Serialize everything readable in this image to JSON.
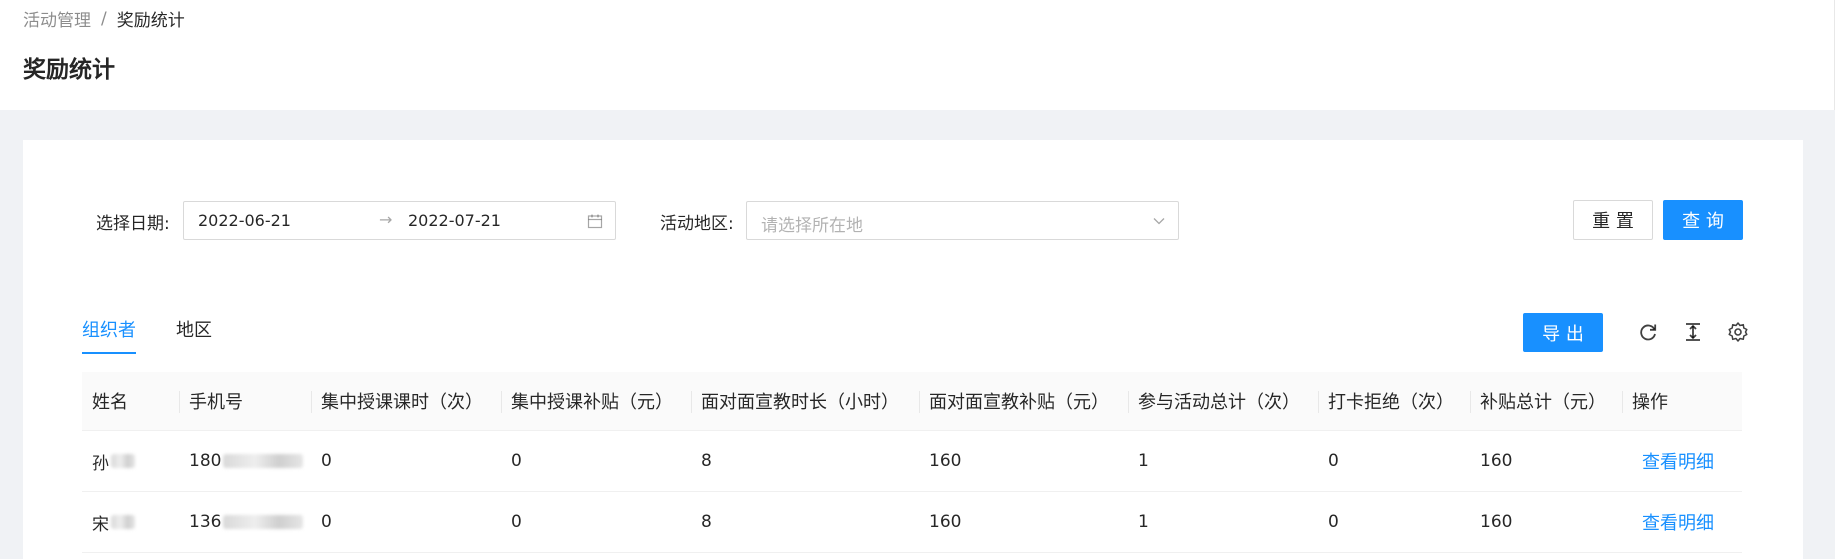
{
  "breadcrumb": {
    "parent": "活动管理",
    "separator": "/",
    "current": "奖励统计"
  },
  "page_title": "奖励统计",
  "filters": {
    "date_label": "选择日期:",
    "start_date": "2022-06-21",
    "range_arrow": "→",
    "end_date": "2022-07-21",
    "region_label": "活动地区:",
    "region_placeholder": "请选择所在地",
    "reset_label": "重 置",
    "query_label": "查 询"
  },
  "tabs": [
    {
      "label": "组织者",
      "active": true
    },
    {
      "label": "地区",
      "active": false
    }
  ],
  "toolbar": {
    "export_label": "导 出"
  },
  "table": {
    "columns": [
      "姓名",
      "手机号",
      "集中授课课时（次）",
      "集中授课补贴（元）",
      "面对面宣教时长（小时）",
      "面对面宣教补贴（元）",
      "参与活动总计（次）",
      "打卡拒绝（次）",
      "补贴总计（元）",
      "操作"
    ],
    "rows": [
      {
        "name": "孙",
        "phone": "180",
        "lesson_count": "0",
        "lesson_subsidy": "0",
        "f2f_hours": "8",
        "f2f_subsidy": "160",
        "activity_total": "1",
        "checkin_reject": "0",
        "subsidy_total": "160",
        "action": "查看明细"
      },
      {
        "name": "宋",
        "phone": "136",
        "lesson_count": "0",
        "lesson_subsidy": "0",
        "f2f_hours": "8",
        "f2f_subsidy": "160",
        "activity_total": "1",
        "checkin_reject": "0",
        "subsidy_total": "160",
        "action": "查看明细"
      }
    ]
  },
  "colors": {
    "primary": "#1890ff",
    "background": "#f0f2f5",
    "header_bg": "#fafafa"
  },
  "icons": {
    "calendar": "calendar-icon",
    "chevron": "chevron-down-icon",
    "reload": "reload-icon",
    "density": "column-height-icon",
    "settings": "setting-icon"
  }
}
